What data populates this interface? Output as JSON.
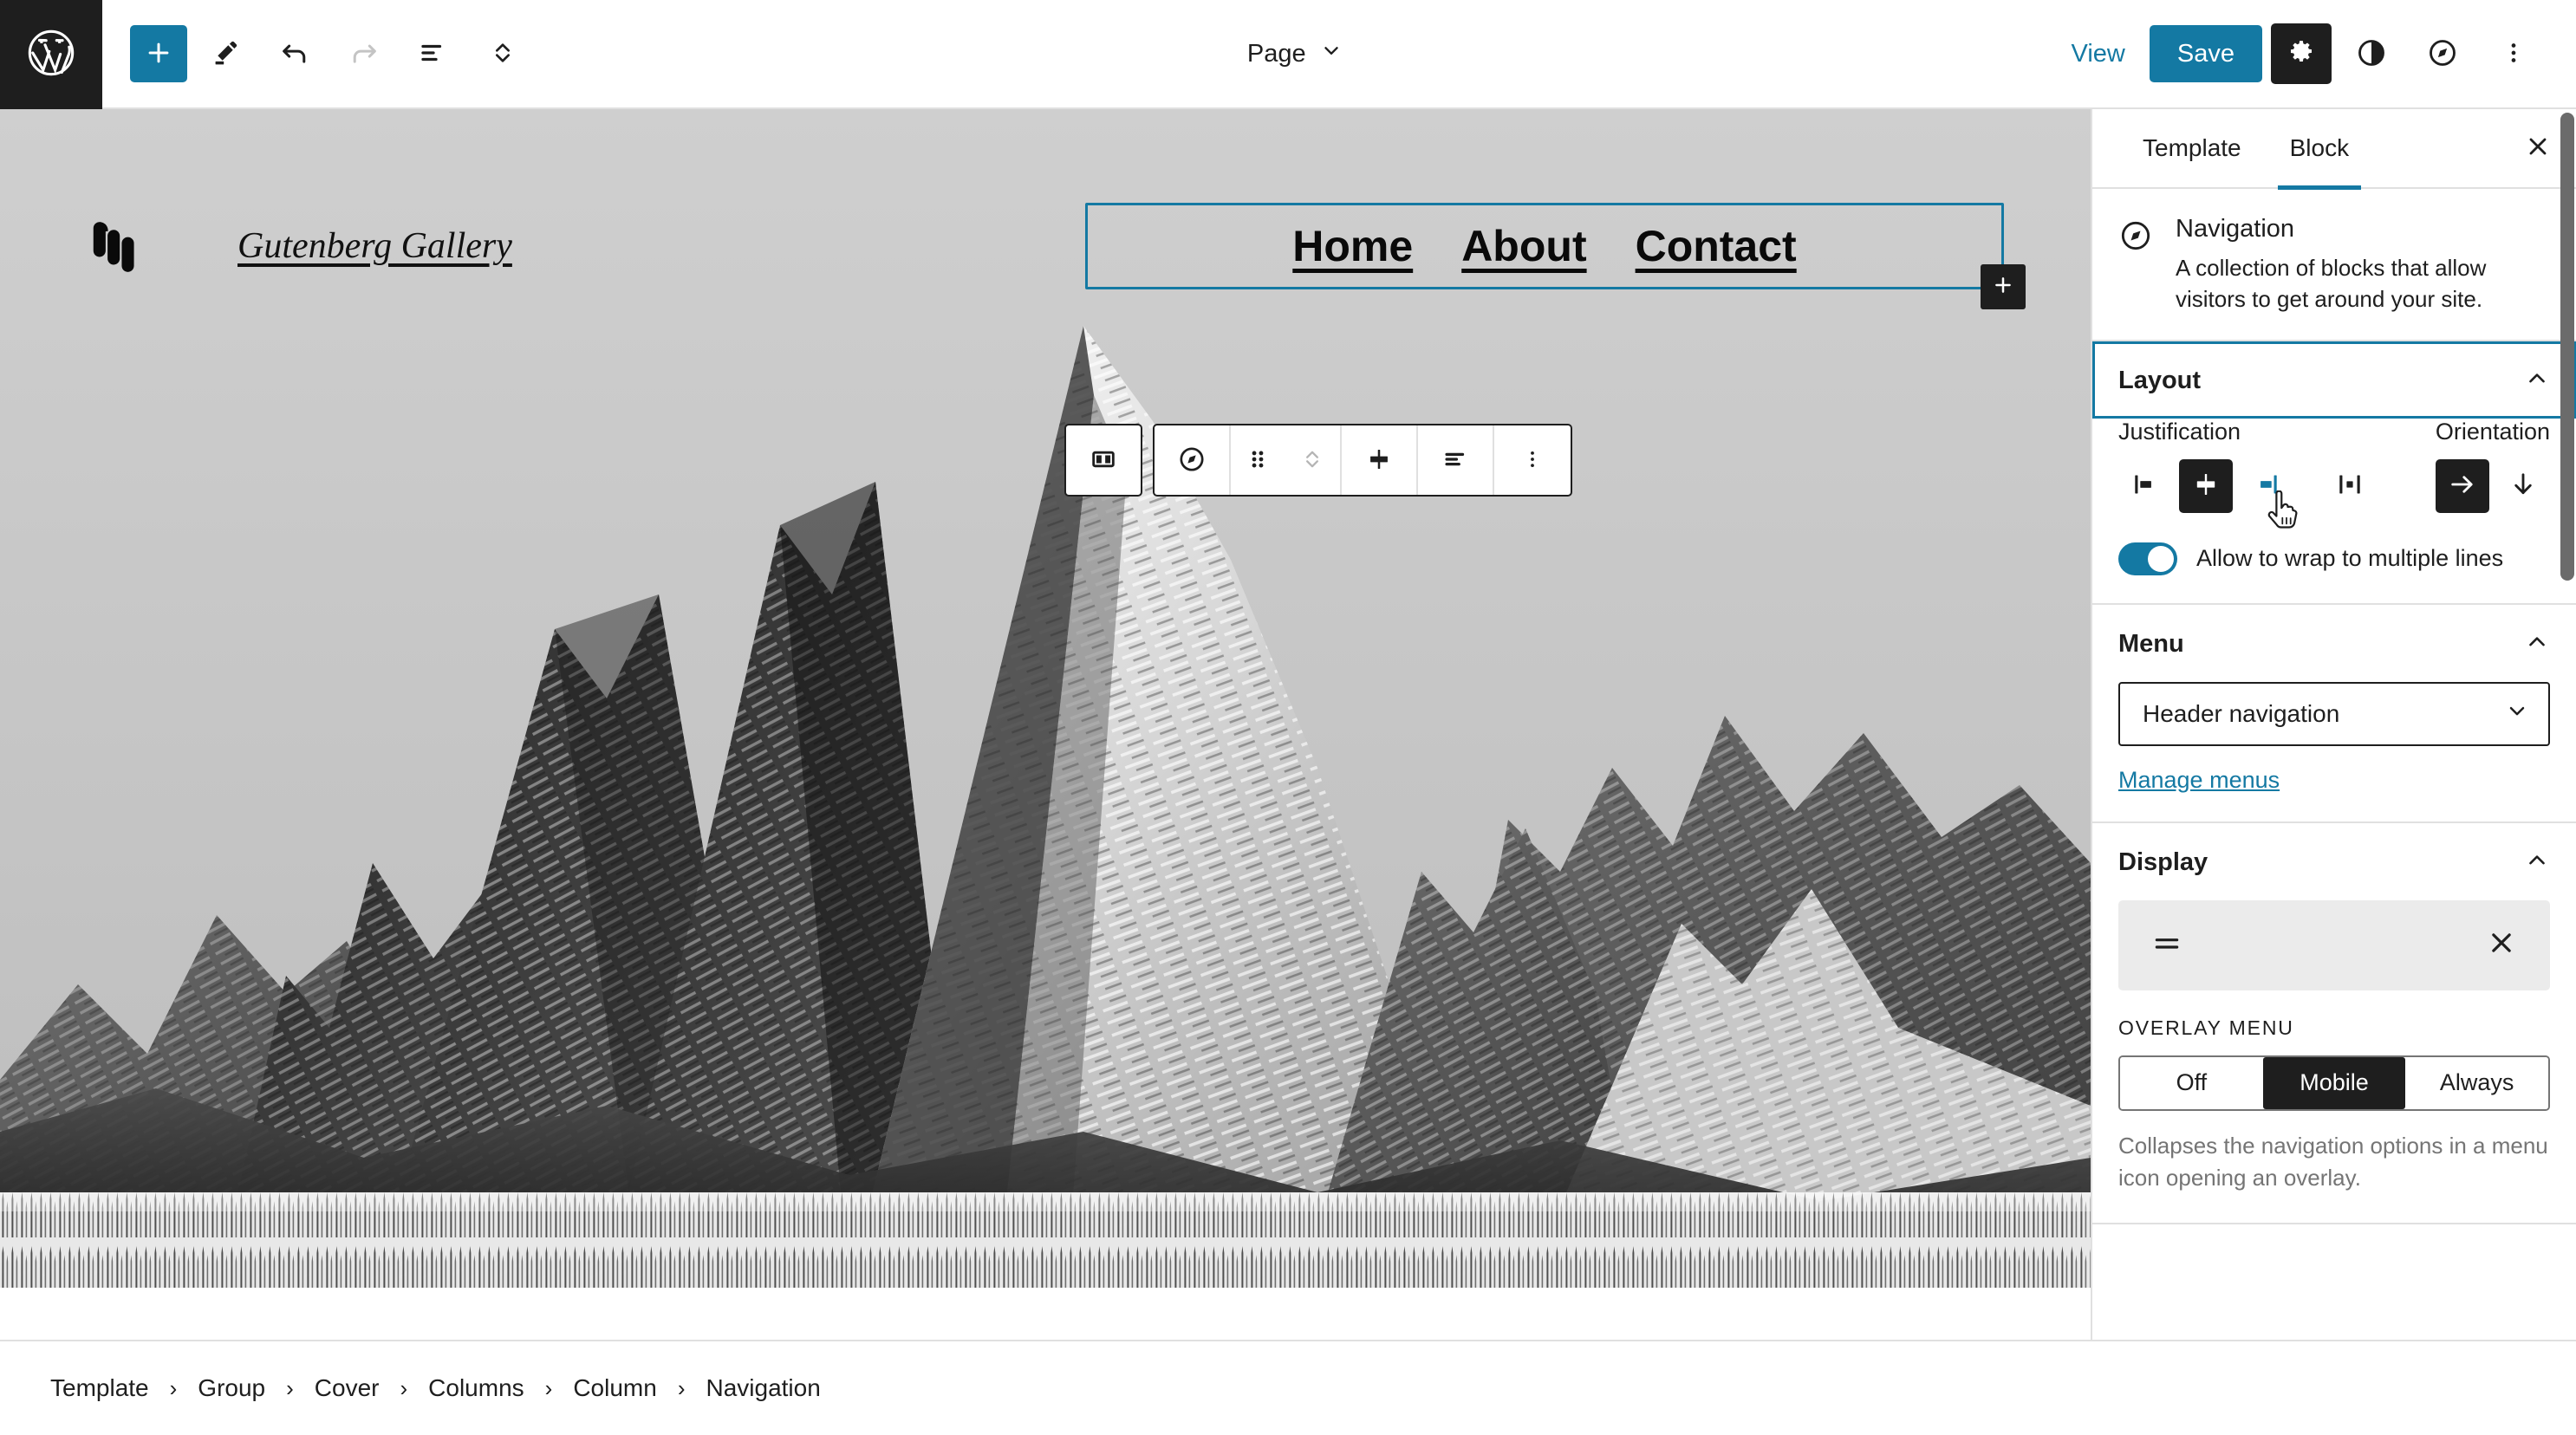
{
  "header": {
    "logo_icon": "wordpress-logo-icon",
    "tools": [
      {
        "name": "add-block-button",
        "icon": "plus-icon",
        "label": "Add block"
      },
      {
        "name": "edit-tool-button",
        "icon": "pencil-icon",
        "label": "Tools"
      },
      {
        "name": "undo-button",
        "icon": "undo-arrow-icon",
        "label": "Undo"
      },
      {
        "name": "redo-button",
        "icon": "redo-arrow-icon",
        "label": "Redo"
      },
      {
        "name": "list-view-button",
        "icon": "list-view-icon",
        "label": "Document Overview"
      },
      {
        "name": "block-mover-button",
        "icon": "chevron-up-down-icon",
        "label": "Move"
      }
    ],
    "document_title": "Page",
    "document_chevron": "chevron-down-icon",
    "view_label": "View",
    "save_label": "Save",
    "settings_icon": "gear-icon",
    "styles_icon": "contrast-half-circle-icon",
    "navigation_icon": "compass-icon",
    "options_icon": "three-dots-vertical-icon"
  },
  "canvas": {
    "site_logo_icon": "site-logo-mark-icon",
    "site_title": "Gutenberg Gallery",
    "nav_items": [
      {
        "label": "Home"
      },
      {
        "label": "About"
      },
      {
        "label": "Contact"
      }
    ],
    "appender_icon": "plus-icon",
    "appender_label": "Add block",
    "block_toolbar": [
      {
        "name": "toolbar-parent-columns-button",
        "icon": "columns-icon"
      },
      {
        "name": "toolbar-block-type-navigation-button",
        "icon": "compass-icon"
      },
      {
        "name": "toolbar-drag-handle",
        "icon": "drag-dots-icon"
      },
      {
        "name": "toolbar-move-up-down",
        "icon": "chevron-up-down-icon"
      },
      {
        "name": "toolbar-add-block-button",
        "icon": "plus-block-icon"
      },
      {
        "name": "toolbar-justify-button",
        "icon": "justify-icon"
      },
      {
        "name": "toolbar-more-options-button",
        "icon": "three-dots-vertical-icon"
      }
    ]
  },
  "sidebar": {
    "tabs": [
      {
        "label": "Template",
        "active": false
      },
      {
        "label": "Block",
        "active": true
      }
    ],
    "close_icon": "close-x-icon",
    "block_card": {
      "icon": "compass-icon",
      "title": "Navigation",
      "description": "A collection of blocks that allow visitors to get around your site."
    },
    "layout_panel": {
      "title": "Layout",
      "chevron": "chevron-up-icon",
      "justification_label": "Justification",
      "orientation_label": "Orientation",
      "justification_options": [
        {
          "name": "justify-left",
          "icon": "justify-left-icon",
          "state": "default"
        },
        {
          "name": "justify-center",
          "icon": "justify-center-icon",
          "state": "selected"
        },
        {
          "name": "justify-right",
          "icon": "justify-right-icon",
          "state": "hovered"
        },
        {
          "name": "justify-space-between",
          "icon": "justify-space-between-icon",
          "state": "default"
        }
      ],
      "orientation_options": [
        {
          "name": "orientation-horizontal",
          "icon": "arrow-right-icon",
          "state": "selected"
        },
        {
          "name": "orientation-vertical",
          "icon": "arrow-down-icon",
          "state": "default"
        }
      ],
      "wrap_toggle_label": "Allow to wrap to multiple lines",
      "wrap_toggle_on": true
    },
    "menu_panel": {
      "title": "Menu",
      "chevron": "chevron-up-icon",
      "selected_menu": "Header navigation",
      "select_chevron": "chevron-down-icon",
      "manage_link": "Manage menus"
    },
    "display_panel": {
      "title": "Display",
      "chevron": "chevron-up-icon",
      "open_icon": "hamburger-menu-icon",
      "close_icon": "close-x-icon",
      "overlay_label": "OVERLAY MENU",
      "overlay_options": [
        {
          "label": "Off",
          "active": false
        },
        {
          "label": "Mobile",
          "active": true
        },
        {
          "label": "Always",
          "active": false
        }
      ],
      "help_text": "Collapses the navigation options in a menu icon opening an overlay."
    }
  },
  "breadcrumb": {
    "separator": "›",
    "items": [
      {
        "label": "Template"
      },
      {
        "label": "Group"
      },
      {
        "label": "Cover"
      },
      {
        "label": "Columns"
      },
      {
        "label": "Column"
      },
      {
        "label": "Navigation"
      }
    ]
  },
  "colors": {
    "accent_blue": "#1479a3",
    "dark": "#1e1e1e",
    "border": "#e0e0e0",
    "muted": "#757575"
  }
}
